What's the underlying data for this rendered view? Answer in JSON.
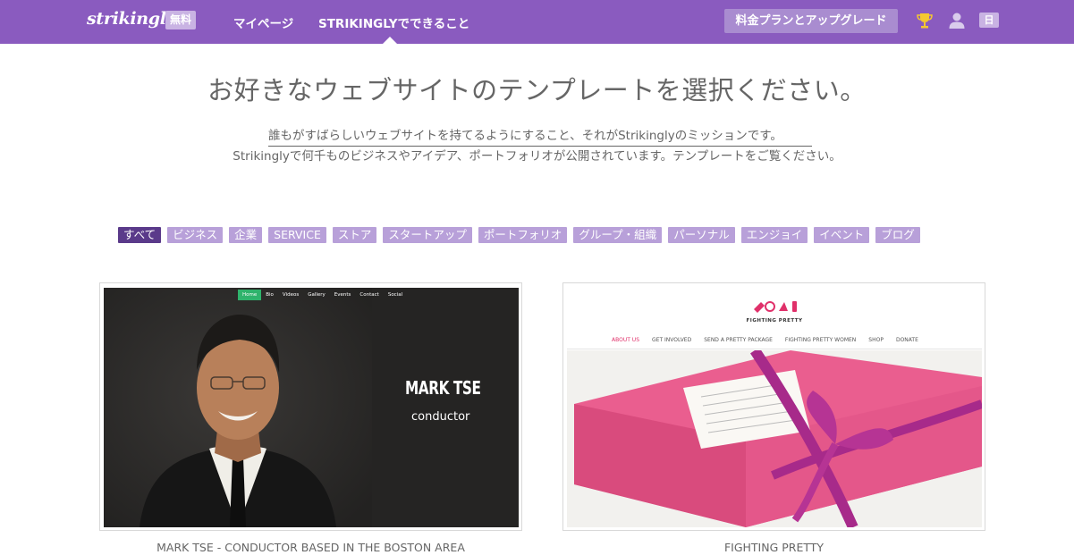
{
  "header": {
    "logo": "strikingly",
    "plan_badge": "無料",
    "nav": [
      {
        "label": "マイページ"
      },
      {
        "label": "STRIKINGLYでできること"
      }
    ],
    "upgrade_button": "料金プランとアップグレード",
    "language_badge": "日",
    "icons": [
      "trophy-icon",
      "user-icon"
    ]
  },
  "intro": {
    "title": "お好きなウェブサイトのテンプレートを選択ください。",
    "subtitle_line1": "誰もがすばらしいウェブサイトを持てるようにすること、それがStrikinglyのミッションです。",
    "subtitle_line2": "Strikinglyで何千ものビジネスやアイデア、ポートフォリオが公開されています。テンプレートをご覧ください。"
  },
  "filters": [
    {
      "label": "すべて",
      "active": true
    },
    {
      "label": "ビジネス",
      "active": false
    },
    {
      "label": "企業",
      "active": false
    },
    {
      "label": "SERVICE",
      "active": false
    },
    {
      "label": "ストア",
      "active": false
    },
    {
      "label": "スタートアップ",
      "active": false
    },
    {
      "label": "ポートフォリオ",
      "active": false
    },
    {
      "label": "グループ・組織",
      "active": false
    },
    {
      "label": "パーソナル",
      "active": false
    },
    {
      "label": "エンジョイ",
      "active": false
    },
    {
      "label": "イベント",
      "active": false
    },
    {
      "label": "ブログ",
      "active": false
    }
  ],
  "templates": [
    {
      "caption": "MARK TSE - CONDUCTOR BASED IN THE BOSTON AREA",
      "preview": {
        "nav": [
          "Home",
          "Bio",
          "Videos",
          "Gallery",
          "Events",
          "Contact",
          "Social"
        ],
        "name": "MARK TSE",
        "role": "conductor"
      }
    },
    {
      "caption": "FIGHTING PRETTY",
      "preview": {
        "brand": "FIGHTING PRETTY",
        "nav": [
          "ABOUT US",
          "GET INVOLVED",
          "SEND A PRETTY PACKAGE",
          "FIGHTING PRETTY WOMEN",
          "SHOP",
          "DONATE"
        ]
      }
    }
  ],
  "colors": {
    "header_bg": "#8a5bbf",
    "tag_bg": "#b8a0d9",
    "tag_active_bg": "#5a3a8a",
    "accent_pink": "#e0306a"
  }
}
